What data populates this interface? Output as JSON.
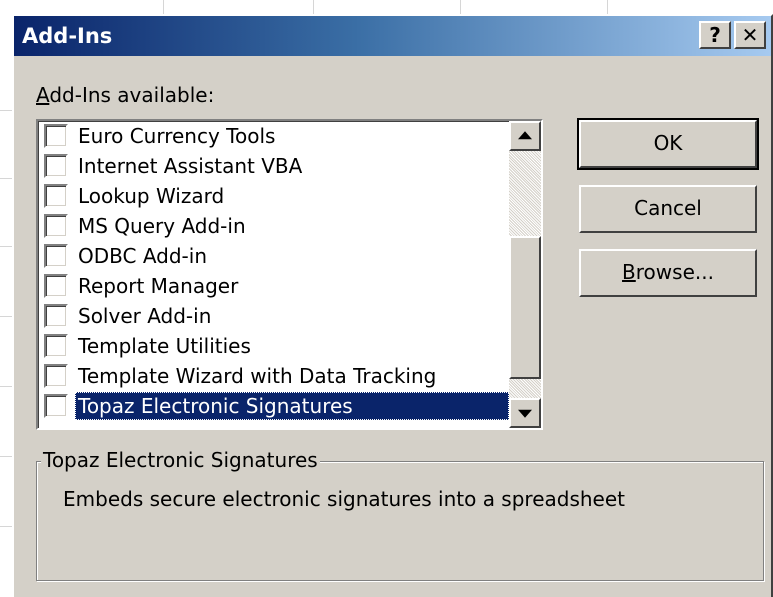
{
  "window": {
    "title": "Add-Ins",
    "help_glyph": "?",
    "close_glyph": "✕"
  },
  "available": {
    "label_first": "A",
    "label_rest": "dd-Ins available:"
  },
  "addins": [
    {
      "label": "Euro Currency Tools",
      "checked": false
    },
    {
      "label": "Internet Assistant VBA",
      "checked": false
    },
    {
      "label": "Lookup Wizard",
      "checked": false
    },
    {
      "label": "MS Query Add-in",
      "checked": false
    },
    {
      "label": "ODBC Add-in",
      "checked": false
    },
    {
      "label": "Report Manager",
      "checked": false
    },
    {
      "label": "Solver Add-in",
      "checked": false
    },
    {
      "label": "Template Utilities",
      "checked": false
    },
    {
      "label": "Template Wizard with Data Tracking",
      "checked": false
    },
    {
      "label": "Topaz Electronic Signatures",
      "checked": false,
      "selected": true
    }
  ],
  "buttons": {
    "ok": "OK",
    "cancel": "Cancel",
    "browse_first": "B",
    "browse_rest": "rowse..."
  },
  "description": {
    "title": "Topaz Electronic Signatures",
    "text": "Embeds secure electronic signatures into a spreadsheet"
  },
  "colors": {
    "dialog_face": "#d4d0c8",
    "titlebar_start": "#0a246a",
    "titlebar_end": "#a6caf0",
    "selection": "#0a246a"
  }
}
